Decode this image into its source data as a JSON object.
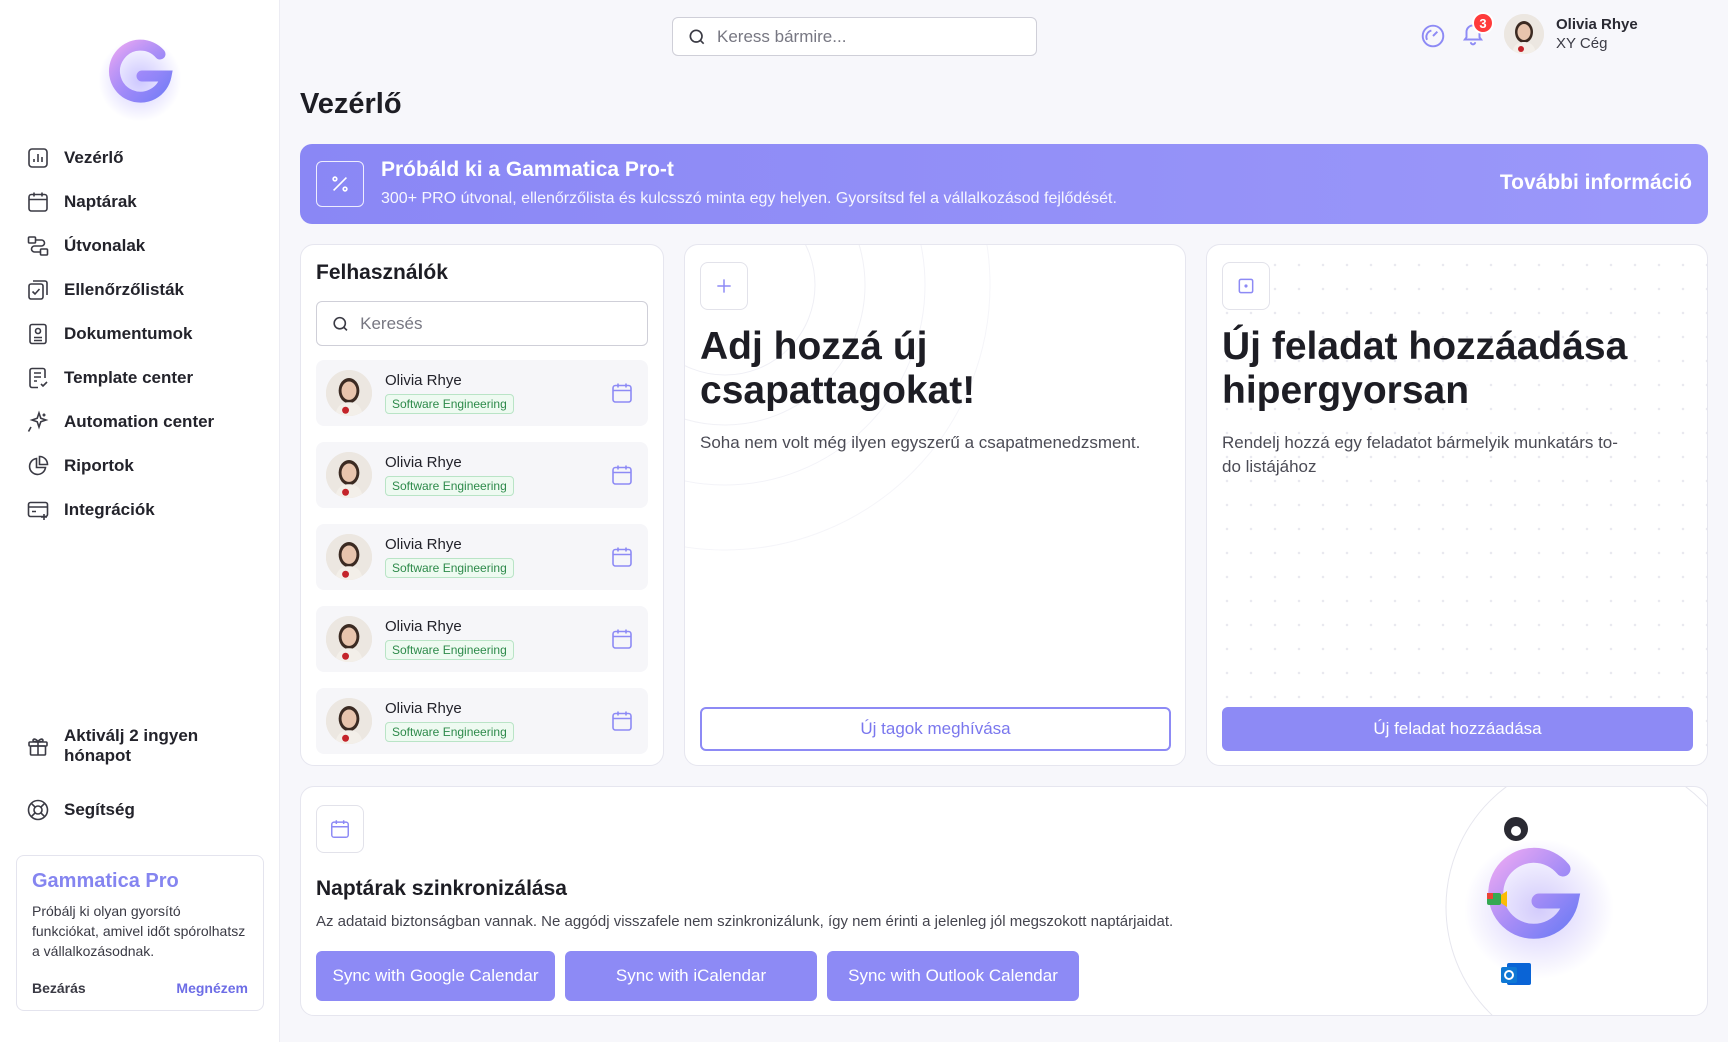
{
  "sidebar": {
    "items": [
      {
        "label": "Vezérlő",
        "icon": "chart-bar-icon"
      },
      {
        "label": "Naptárak",
        "icon": "calendar-icon"
      },
      {
        "label": "Útvonalak",
        "icon": "route-icon"
      },
      {
        "label": "Ellenőrzőlisták",
        "icon": "checklist-icon"
      },
      {
        "label": "Dokumentumok",
        "icon": "document-icon"
      },
      {
        "label": "Template center",
        "icon": "template-icon"
      },
      {
        "label": "Automation center",
        "icon": "sparkle-icon"
      },
      {
        "label": "Riportok",
        "icon": "pie-chart-icon"
      },
      {
        "label": "Integrációk",
        "icon": "integration-icon"
      }
    ],
    "promo_link": "Aktiválj 2 ingyen hónapot",
    "help": "Segítség",
    "pro_card": {
      "title": "Gammatica Pro",
      "text": "Próbálj ki olyan gyorsító funkciókat, amivel időt spórolhatsz a vállalkozásodnak.",
      "close": "Bezárás",
      "cta": "Megnézem"
    }
  },
  "topbar": {
    "search_placeholder": "Keress bármire...",
    "notification_count": "3",
    "user": {
      "name": "Olivia Rhye",
      "company": "XY Cég"
    }
  },
  "page_title": "Vezérlő",
  "banner": {
    "title": "Próbáld ki a Gammatica Pro-t",
    "subtitle": "300+ PRO útvonal, ellenőrzőlista és kulcsszó minta egy helyen. Gyorsítsd fel a vállalkozásod fejlődését.",
    "link": "További információ"
  },
  "users": {
    "title": "Felhasználók",
    "search_placeholder": "Keresés",
    "rows": [
      {
        "name": "Olivia Rhye",
        "tag": "Software Engineering"
      },
      {
        "name": "Olivia Rhye",
        "tag": "Software Engineering"
      },
      {
        "name": "Olivia Rhye",
        "tag": "Software Engineering"
      },
      {
        "name": "Olivia Rhye",
        "tag": "Software Engineering"
      },
      {
        "name": "Olivia Rhye",
        "tag": "Software Engineering"
      }
    ]
  },
  "team_card": {
    "title": "Adj hozzá új csapattagokat!",
    "desc": "Soha nem volt még ilyen egyszerű a csapatmenedzsment.",
    "button": "Új tagok meghívása"
  },
  "task_card": {
    "title": "Új feladat hozzáadása hipergyorsan",
    "desc": "Rendelj hozzá egy feladatot bármelyik munkatárs to-do listájához",
    "button": "Új feladat hozzáadása"
  },
  "sync": {
    "title": "Naptárak szinkronizálása",
    "desc": "Az adataid biztonságban vannak. Ne aggódj visszafele nem szinkronizálunk, így nem érinti a jelenleg jól megszokott naptárjaidat.",
    "buttons": [
      "Sync with Google Calendar",
      "Sync with iCalendar",
      "Sync with Outlook Calendar"
    ]
  },
  "colors": {
    "accent": "#8d8af5",
    "badge": "#ff3b3b",
    "tag_text": "#2d8a4a"
  }
}
